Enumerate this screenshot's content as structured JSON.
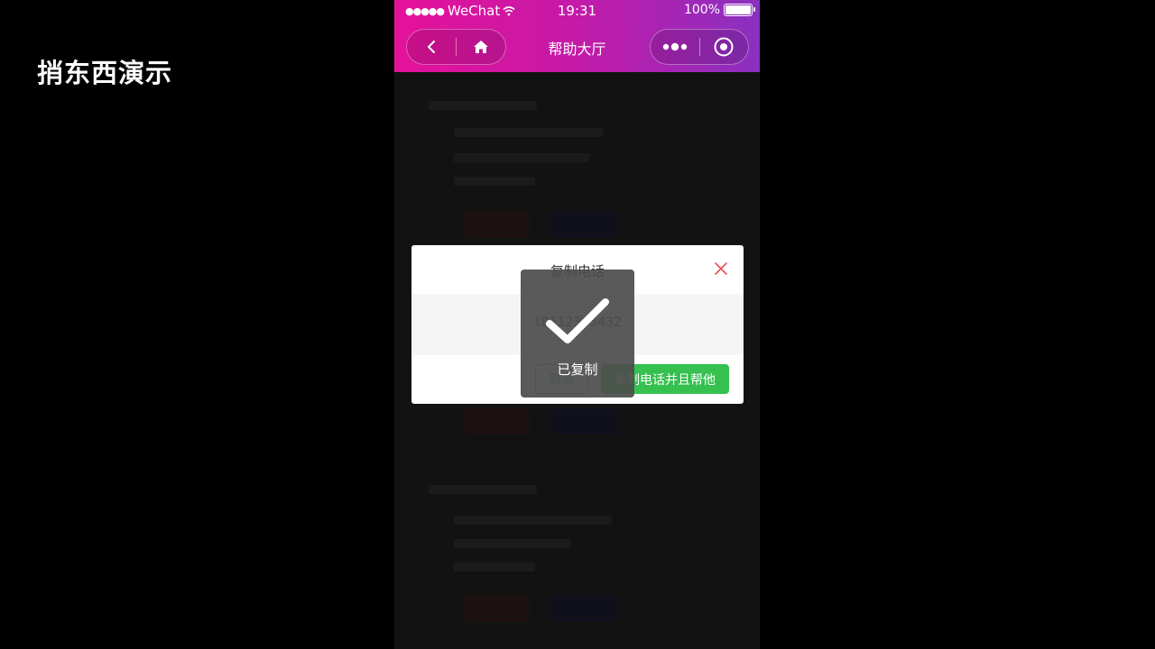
{
  "watermark": {
    "text": "捎东西演示"
  },
  "status_bar": {
    "signal_dots": "●●●●●",
    "carrier": "WeChat",
    "time": "19:31",
    "battery": "100%"
  },
  "nav": {
    "title": "帮助大厅",
    "icons": [
      "back-icon",
      "home-icon",
      "more-icon",
      "capsule-close-icon"
    ]
  },
  "dialog": {
    "title": "复制电话",
    "phone": "18112345432",
    "cancel_label": "取消",
    "confirm_label": "复制电话并且帮他"
  },
  "toast": {
    "text": "已复制"
  },
  "colors": {
    "header_start": "#e5119a",
    "header_end": "#8a30c0",
    "primary_green": "#35c04f",
    "close_red": "#e55353"
  }
}
